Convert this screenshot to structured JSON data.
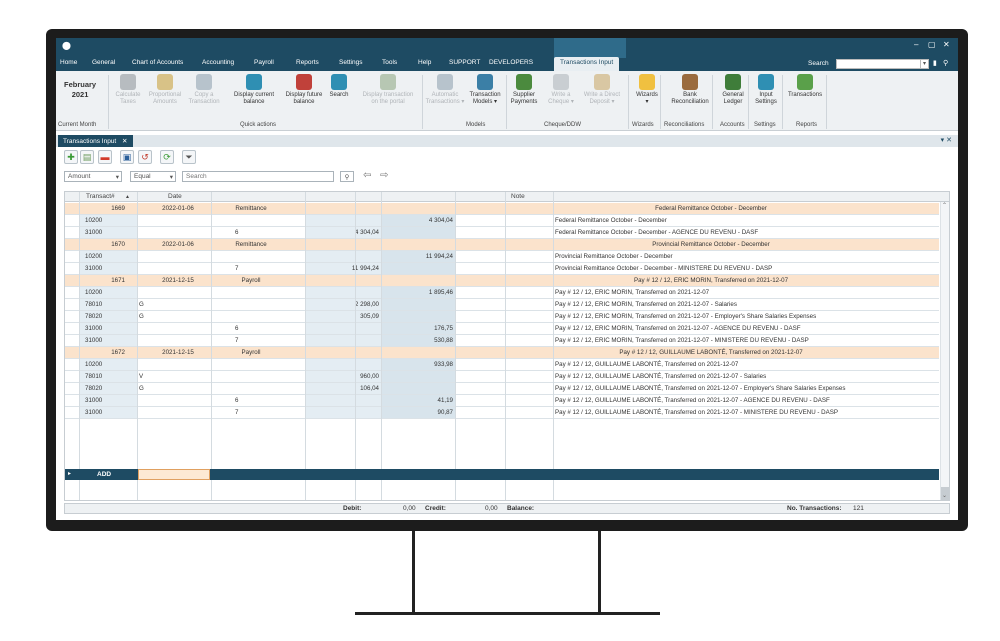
{
  "window": {
    "minimize": "‒",
    "maximize": "▢",
    "close": "✕"
  },
  "menu": {
    "items": [
      "Home",
      "General",
      "Chart of Accounts",
      "Accounting",
      "Payroll",
      "Reports",
      "Settings",
      "Tools",
      "Help",
      "SUPPORT",
      "DEVELOPERS",
      "Transactions Input"
    ],
    "search_label": "Search"
  },
  "ribbon": {
    "month_line1": "February",
    "month_line2": "2021",
    "buttons": [
      {
        "l1": "Calculate",
        "l2": "Taxes",
        "icon": "calculator-icon",
        "color": "#b7bcc0",
        "enabled": false
      },
      {
        "l1": "Proportional",
        "l2": "Amounts",
        "icon": "coins-icon",
        "color": "#d8c287",
        "enabled": false
      },
      {
        "l1": "Copy a",
        "l2": "Transaction",
        "icon": "copy-icon",
        "color": "#b7c3cc",
        "enabled": false
      },
      {
        "l1": "Display current",
        "l2": "balance",
        "icon": "balance-icon",
        "color": "#2f8fb3",
        "enabled": true
      },
      {
        "l1": "Display future",
        "l2": "balance",
        "icon": "calendar-icon",
        "color": "#c0413a",
        "enabled": true
      },
      {
        "l1": "Search",
        "l2": "",
        "icon": "search-icon",
        "color": "#2f8fb3",
        "enabled": true
      },
      {
        "l1": "Display transaction",
        "l2": "on the portal",
        "icon": "portal-icon",
        "color": "#b7c7b3",
        "enabled": false
      },
      {
        "l1": "Automatic",
        "l2": "Transactions ▾",
        "icon": "auto-icon",
        "color": "#b7c3cc",
        "enabled": false
      },
      {
        "l1": "Transaction",
        "l2": "Models ▾",
        "icon": "model-icon",
        "color": "#3b7fa6",
        "enabled": true
      },
      {
        "l1": "Supplier",
        "l2": "Payments",
        "icon": "money-bag-icon",
        "color": "#4b8a3e",
        "enabled": true
      },
      {
        "l1": "Write a",
        "l2": "Cheque ▾",
        "icon": "cheque-icon",
        "color": "#c9ced2",
        "enabled": false
      },
      {
        "l1": "Write a Direct",
        "l2": "Deposit ▾",
        "icon": "deposit-icon",
        "color": "#d9c7a3",
        "enabled": false
      },
      {
        "l1": "Wizards",
        "l2": "▾",
        "icon": "bulb-icon",
        "color": "#f0c040",
        "enabled": true
      },
      {
        "l1": "Bank",
        "l2": "Reconciliation",
        "icon": "bank-icon",
        "color": "#9a6b3e",
        "enabled": true
      },
      {
        "l1": "General",
        "l2": "Ledger",
        "icon": "ledger-icon",
        "color": "#3f7d3a",
        "enabled": true
      },
      {
        "l1": "Input",
        "l2": "Settings",
        "icon": "settings-icon",
        "color": "#2f8fb3",
        "enabled": true
      },
      {
        "l1": "Transactions",
        "l2": "",
        "icon": "add-doc-icon",
        "color": "#5aa04a",
        "enabled": true
      }
    ],
    "groups": [
      "Current Month",
      "Quick actions",
      "Models",
      "Cheque/DDW",
      "Wizards",
      "Reconciliations",
      "Accounts",
      "Settings",
      "Reports"
    ]
  },
  "doc_tab": {
    "label": "Transactions Input",
    "close": "✕"
  },
  "toolbar": {
    "icons": [
      {
        "name": "add-icon",
        "glyph": "✚",
        "color": "#3a9a35"
      },
      {
        "name": "duplicate-icon",
        "glyph": "▤",
        "color": "#6a9a5a"
      },
      {
        "name": "delete-icon",
        "glyph": "▬",
        "color": "#d23a2a"
      },
      {
        "name": "save-icon",
        "glyph": "▣",
        "color": "#2a5f9a"
      },
      {
        "name": "undo-icon",
        "glyph": "↺",
        "color": "#c23a2a"
      },
      {
        "name": "refresh-icon",
        "glyph": "⟳",
        "color": "#3a9a35"
      },
      {
        "name": "filter-icon",
        "glyph": "⏷",
        "color": "#555555"
      }
    ]
  },
  "filter": {
    "field": "Amount",
    "operator": "Equal",
    "search_placeholder": "Search"
  },
  "grid": {
    "headers": {
      "transact": "Transact#",
      "sort": "▲",
      "date": "Date",
      "note": "Note"
    },
    "groups": [
      {
        "num": "1669",
        "date": "2022-01-06",
        "type": "Remittance",
        "note": "Federal Remittance October - December",
        "lines": [
          {
            "acct": "10200",
            "c": "",
            "d": "",
            "debit": "",
            "credit": "4 304,04",
            "note": "Federal Remittance October - December"
          },
          {
            "acct": "31000",
            "c": "",
            "d": "6",
            "debit": "4 304,04",
            "credit": "",
            "note": "Federal Remittance October - December - AGENCE DU REVENU - DASF"
          }
        ]
      },
      {
        "num": "1670",
        "date": "2022-01-06",
        "type": "Remittance",
        "note": "Provincial Remittance October - December",
        "lines": [
          {
            "acct": "10200",
            "c": "",
            "d": "",
            "debit": "",
            "credit": "11 994,24",
            "note": "Provincial Remittance October - December"
          },
          {
            "acct": "31000",
            "c": "",
            "d": "7",
            "debit": "11 994,24",
            "credit": "",
            "note": "Provincial Remittance October - December - MINISTERE DU REVENU - DASP"
          }
        ]
      },
      {
        "num": "1671",
        "date": "2021-12-15",
        "type": "Payroll",
        "note": "Pay # 12 / 12, ERIC MORIN, Transferred on 2021-12-07",
        "lines": [
          {
            "acct": "10200",
            "c": "",
            "d": "",
            "debit": "",
            "credit": "1 895,46",
            "note": "Pay # 12 / 12, ERIC MORIN, Transferred on 2021-12-07"
          },
          {
            "acct": "78010",
            "c": "G",
            "d": "",
            "debit": "2 298,00",
            "credit": "",
            "note": "Pay # 12 / 12, ERIC MORIN, Transferred on 2021-12-07 - Salaries"
          },
          {
            "acct": "78020",
            "c": "G",
            "d": "",
            "debit": "305,09",
            "credit": "",
            "note": "Pay # 12 / 12, ERIC MORIN, Transferred on 2021-12-07 - Employer's Share Salaries Expenses"
          },
          {
            "acct": "31000",
            "c": "",
            "d": "6",
            "debit": "",
            "credit": "176,75",
            "note": "Pay # 12 / 12, ERIC MORIN, Transferred on 2021-12-07 - AGENCE DU REVENU - DASF"
          },
          {
            "acct": "31000",
            "c": "",
            "d": "7",
            "debit": "",
            "credit": "530,88",
            "note": "Pay # 12 / 12, ERIC MORIN, Transferred on 2021-12-07 - MINISTERE DU REVENU - DASP"
          }
        ]
      },
      {
        "num": "1672",
        "date": "2021-12-15",
        "type": "Payroll",
        "note": "Pay # 12 / 12, GUILLAUME LABONTÉ, Transferred on 2021-12-07",
        "lines": [
          {
            "acct": "10200",
            "c": "",
            "d": "",
            "debit": "",
            "credit": "933,98",
            "note": "Pay # 12 / 12, GUILLAUME LABONTÉ, Transferred on 2021-12-07"
          },
          {
            "acct": "78010",
            "c": "V",
            "d": "",
            "debit": "960,00",
            "credit": "",
            "note": "Pay # 12 / 12, GUILLAUME LABONTÉ, Transferred on 2021-12-07 - Salaries"
          },
          {
            "acct": "78020",
            "c": "G",
            "d": "",
            "debit": "106,04",
            "credit": "",
            "note": "Pay # 12 / 12, GUILLAUME LABONTÉ, Transferred on 2021-12-07 - Employer's Share Salaries Expenses"
          },
          {
            "acct": "31000",
            "c": "",
            "d": "6",
            "debit": "",
            "credit": "41,19",
            "note": "Pay # 12 / 12, GUILLAUME LABONTÉ, Transferred on 2021-12-07 - AGENCE DU REVENU - DASF"
          },
          {
            "acct": "31000",
            "c": "",
            "d": "7",
            "debit": "",
            "credit": "90,87",
            "note": "Pay # 12 / 12, GUILLAUME LABONTÉ, Transferred on 2021-12-07 - MINISTERE DU REVENU - DASP"
          }
        ]
      }
    ],
    "add_label": "ADD",
    "row_marker": "▸"
  },
  "status": {
    "debit_label": "Debit:",
    "debit_value": "0,00",
    "credit_label": "Credit:",
    "credit_value": "0,00",
    "balance_label": "Balance:",
    "count_label": "No. Transactions:",
    "count_value": "121"
  },
  "colors": {
    "accent": "#1e4b63",
    "group_row": "#fbe3cc"
  }
}
